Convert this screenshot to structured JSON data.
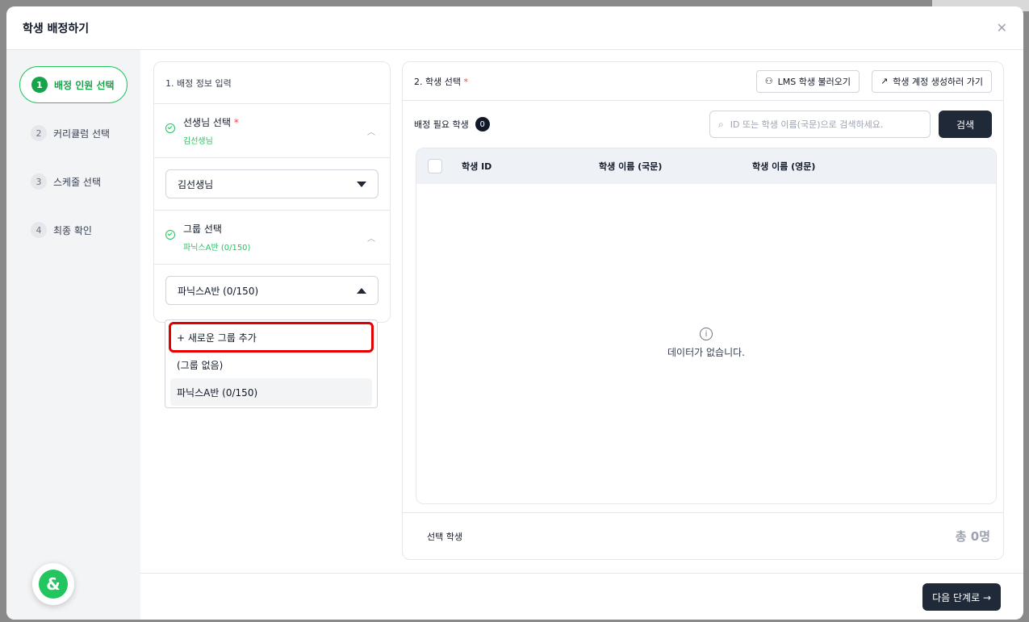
{
  "modal": {
    "title": "학생 배정하기",
    "close": "✕"
  },
  "steps": [
    {
      "num": "1",
      "label": "배정 인원 선택"
    },
    {
      "num": "2",
      "label": "커리큘럼 선택"
    },
    {
      "num": "3",
      "label": "스케줄 선택"
    },
    {
      "num": "4",
      "label": "최종 확인"
    }
  ],
  "fab": {
    "glyph": "&"
  },
  "left_panel": {
    "title": "1. 배정 정보 입력",
    "teacher": {
      "title": "선생님 선택",
      "required": "*",
      "selected": "김선생님",
      "value": "김선생님"
    },
    "group": {
      "title": "그룹 선택",
      "selected": "파닉스A반 (0/150)",
      "value": "파닉스A반 (0/150)"
    },
    "dropdown_options": [
      "+ 새로운 그룹 추가",
      "(그룹 없음)",
      "파닉스A반 (0/150)"
    ]
  },
  "right_panel": {
    "title": "2. 학생 선택",
    "required": "*",
    "lms_button": "LMS 학생 불러오기",
    "create_button": "학생 계정 생성하러 가기",
    "need_label": "배정 필요 학생",
    "need_count": "0",
    "search_placeholder": "ID 또는 학생 이름(국문)으로 검색하세요.",
    "search_button": "검색",
    "columns": [
      "학생 ID",
      "학생 이름 (국문)",
      "학생 이름 (영문)"
    ],
    "empty_text": "데이터가 없습니다.",
    "footer_label": "선택 학생",
    "footer_total": "총 0명"
  },
  "next_button": "다음 단계로 →"
}
